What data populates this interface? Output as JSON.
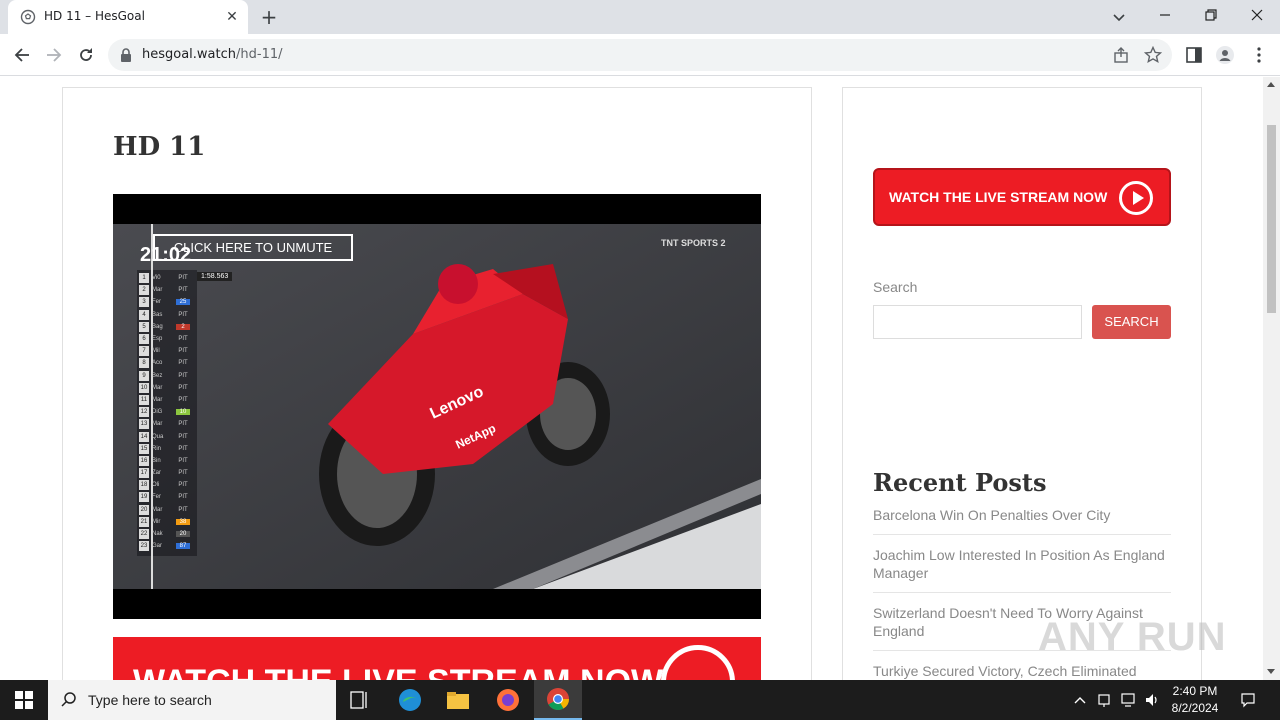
{
  "browser": {
    "tab_title": "HD 11 – HesGoal",
    "url_host": "hesgoal.watch",
    "url_path": "/hd-11/"
  },
  "page": {
    "title": "HD 11",
    "player": {
      "unmute_label": "CLICK HERE TO UNMUTE",
      "clock": "21:02",
      "broadcaster": "TNT SPORTS 2",
      "lap_time": "1:58.563",
      "leaderboard": [
        {
          "pos": "1",
          "name": "Vi0",
          "stat": "PIT"
        },
        {
          "pos": "2",
          "name": "Mar",
          "stat": "PIT"
        },
        {
          "pos": "3",
          "name": "Fer",
          "stat": "25"
        },
        {
          "pos": "4",
          "name": "Bas",
          "stat": "PIT"
        },
        {
          "pos": "5",
          "name": "Bag",
          "stat": "2"
        },
        {
          "pos": "6",
          "name": "Esp",
          "stat": "PIT"
        },
        {
          "pos": "7",
          "name": "Mil",
          "stat": "PIT"
        },
        {
          "pos": "8",
          "name": "Aco",
          "stat": "PIT"
        },
        {
          "pos": "9",
          "name": "Bez",
          "stat": "PIT"
        },
        {
          "pos": "10",
          "name": "Mar",
          "stat": "PIT"
        },
        {
          "pos": "11",
          "name": "Mar",
          "stat": "PIT"
        },
        {
          "pos": "12",
          "name": "DiG",
          "stat": "10"
        },
        {
          "pos": "13",
          "name": "Mar",
          "stat": "PIT"
        },
        {
          "pos": "14",
          "name": "Qua",
          "stat": "PIT"
        },
        {
          "pos": "15",
          "name": "Rin",
          "stat": "PIT"
        },
        {
          "pos": "16",
          "name": "Bin",
          "stat": "PIT"
        },
        {
          "pos": "17",
          "name": "Zar",
          "stat": "PIT"
        },
        {
          "pos": "18",
          "name": "Oli",
          "stat": "PIT"
        },
        {
          "pos": "19",
          "name": "Fer",
          "stat": "PIT"
        },
        {
          "pos": "20",
          "name": "Mar",
          "stat": "PIT"
        },
        {
          "pos": "21",
          "name": "Mir",
          "stat": "38"
        },
        {
          "pos": "22",
          "name": "Nak",
          "stat": "20"
        },
        {
          "pos": "23",
          "name": "Gar",
          "stat": "87"
        }
      ]
    },
    "bottom_banner_text": "WATCH THE LIVE STREAM NOW"
  },
  "sidebar": {
    "watch_button": "WATCH THE LIVE STREAM NOW",
    "search_label": "Search",
    "search_placeholder": "",
    "search_button": "SEARCH",
    "recent_heading": "Recent Posts",
    "recent_posts": [
      "Barcelona Win On Penalties Over City",
      "Joachim Low Interested In Position As England Manager",
      "Switzerland Doesn't Need To Worry Against England",
      "Turkiye Secured Victory, Czech Eliminated"
    ]
  },
  "watermark": "ANY RUN",
  "taskbar": {
    "search_placeholder": "Type here to search",
    "time": "2:40 PM",
    "date": "8/2/2024"
  },
  "colors": {
    "accent_red": "#ed1c24",
    "search_button": "#d9534f"
  }
}
